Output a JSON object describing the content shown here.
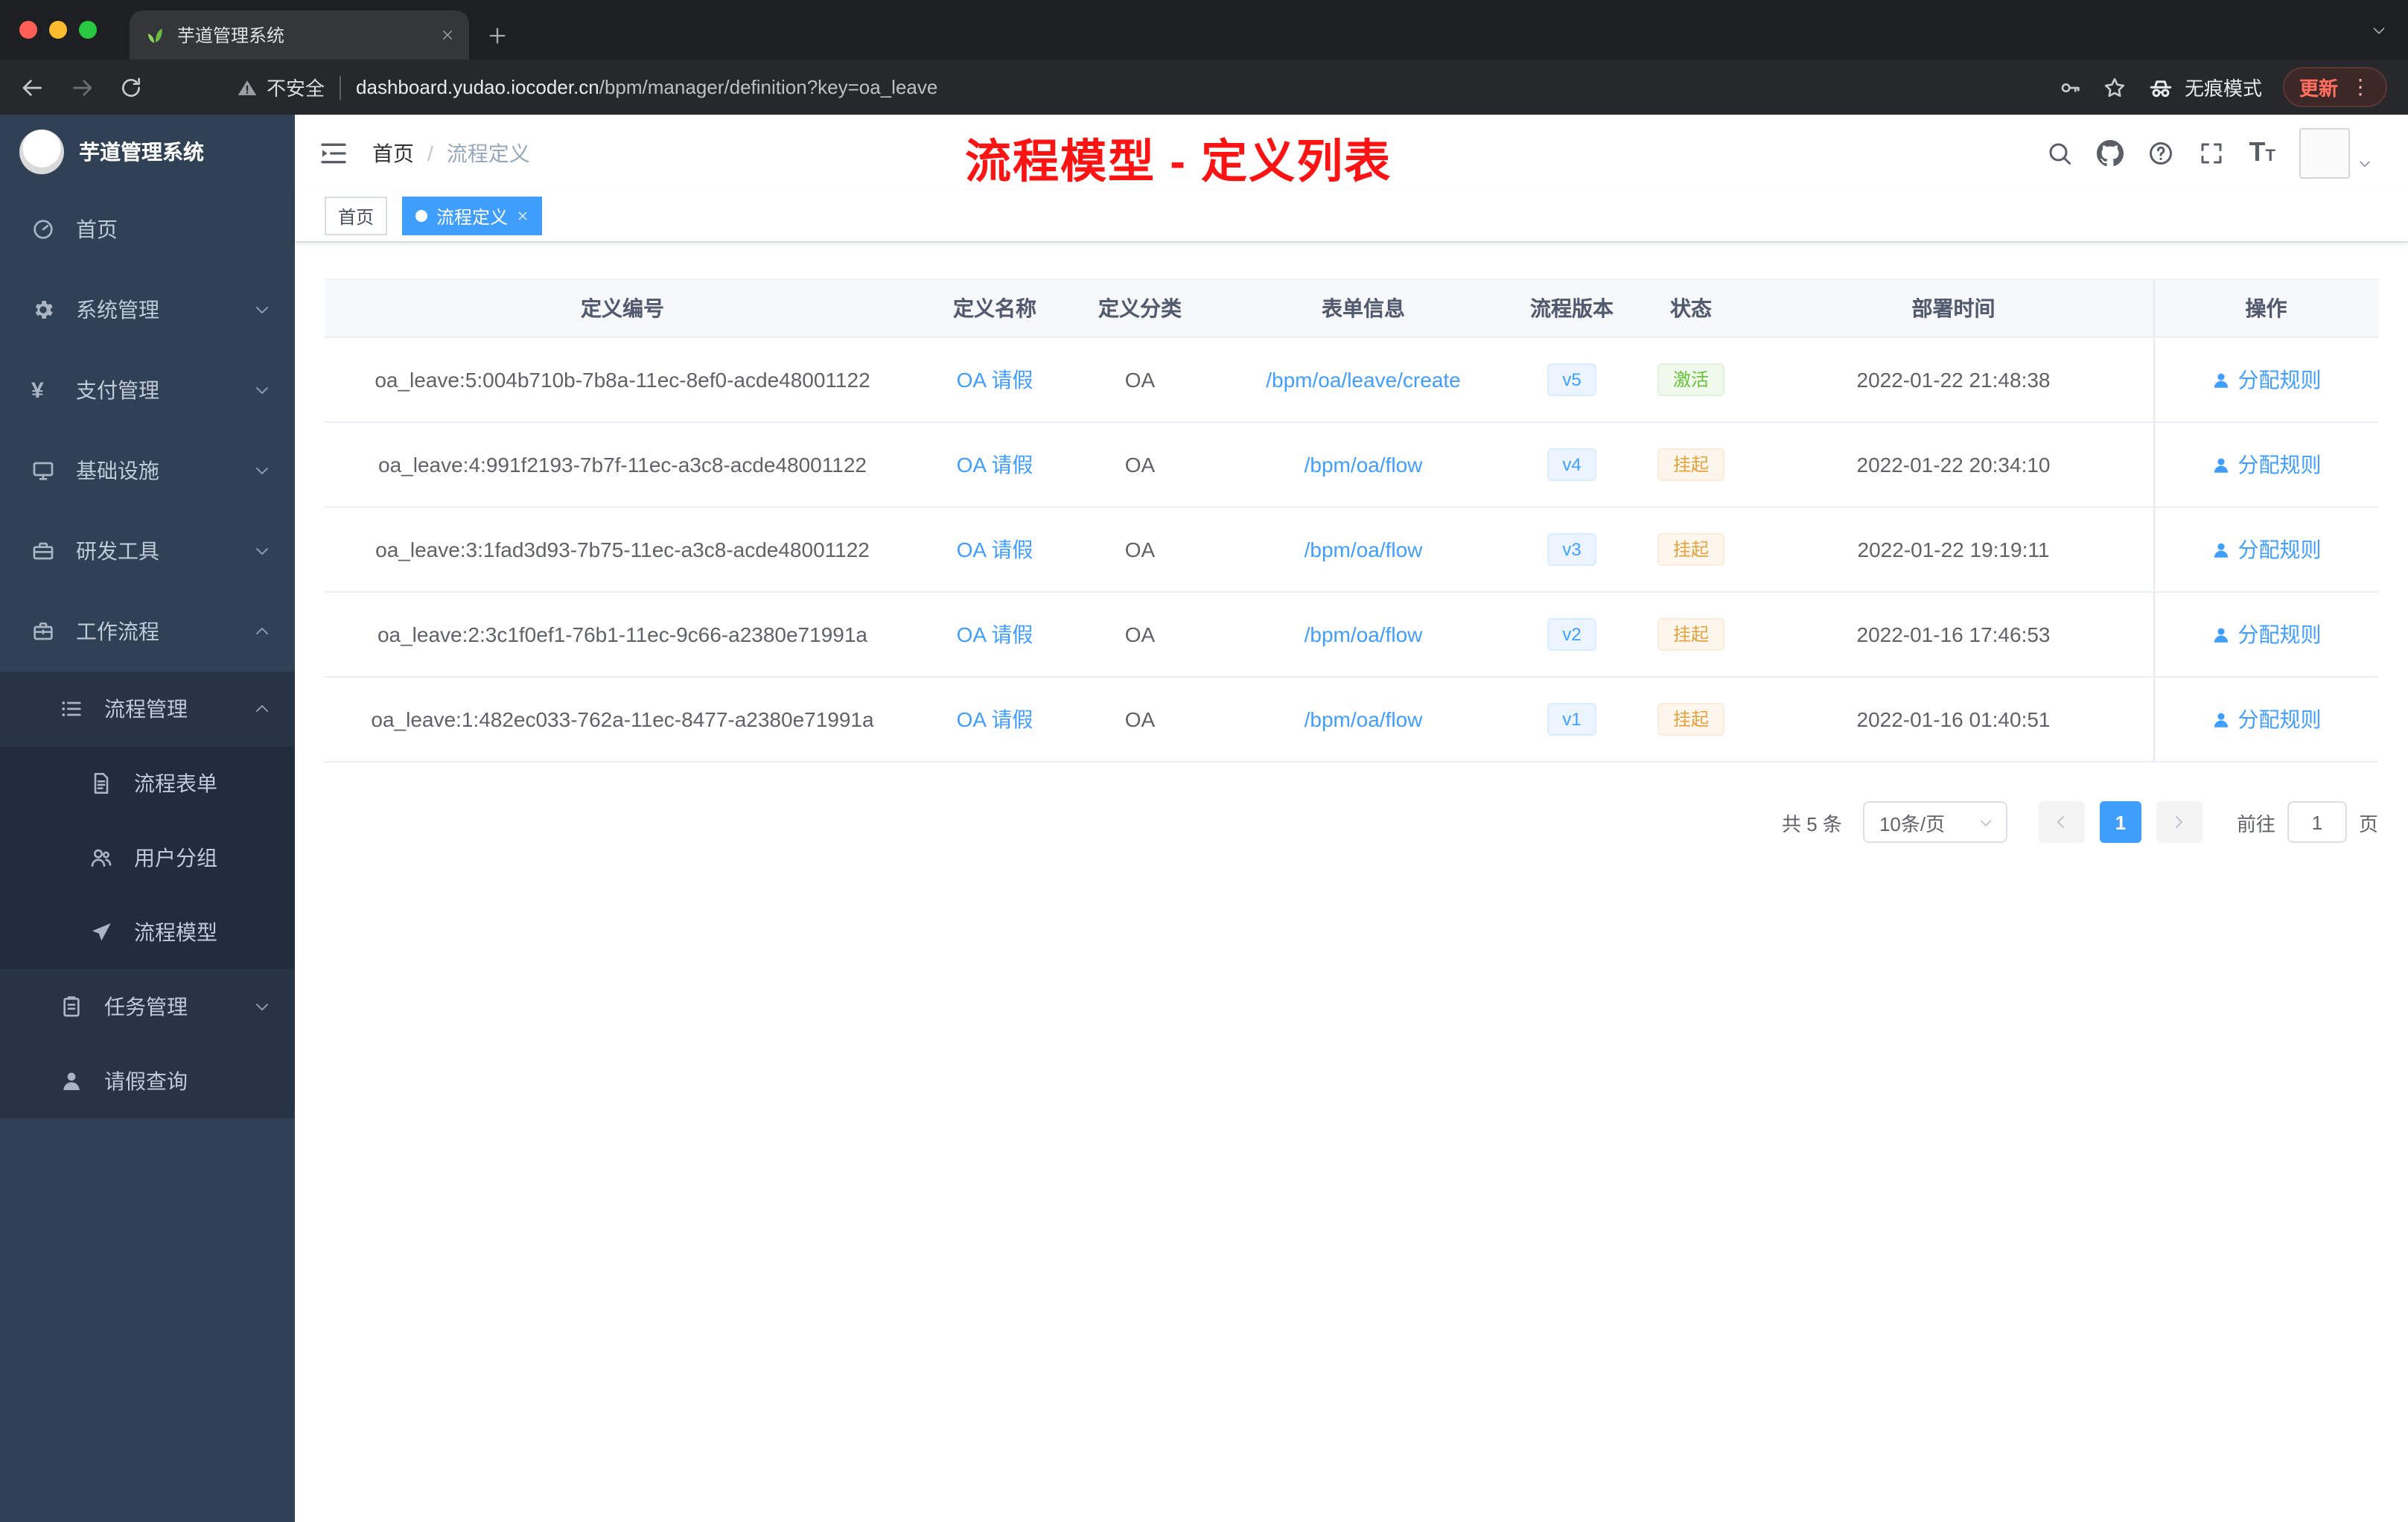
{
  "colors": {
    "accent": "#409eff",
    "annotation_red": "#fa1414",
    "success_text": "#67c23a",
    "success_bg": "#f0f9eb",
    "success_border": "#e1f3d8",
    "warning_text": "#e6a23c",
    "warning_bg": "#fdf6ec",
    "warning_border": "#faecd8",
    "version_bg": "#ecf5ff",
    "version_border": "#d9ecff",
    "sidebar_bg": "#304156",
    "sidebar_sub_bg": "#263445",
    "sidebar_sub2_bg": "#212d3d"
  },
  "browser": {
    "tab_title": "芋道管理系统",
    "security_label": "不安全",
    "url_domain": "dashboard.yudao.iocoder.cn",
    "url_path": "/bpm/manager/definition?key=oa_leave",
    "incognito_label": "无痕模式",
    "update_label": "更新"
  },
  "sidebar": {
    "logo_title": "芋道管理系统",
    "items": [
      {
        "label": "首页"
      },
      {
        "label": "系统管理"
      },
      {
        "label": "支付管理"
      },
      {
        "label": "基础设施"
      },
      {
        "label": "研发工具"
      },
      {
        "label": "工作流程"
      },
      {
        "label": "流程管理"
      },
      {
        "label": "流程表单"
      },
      {
        "label": "用户分组"
      },
      {
        "label": "流程模型"
      },
      {
        "label": "任务管理"
      },
      {
        "label": "请假查询"
      }
    ]
  },
  "navbar": {
    "breadcrumb_home": "首页",
    "breadcrumb_separator": "/",
    "breadcrumb_current": "流程定义",
    "annotation": "流程模型 - 定义列表"
  },
  "tags": {
    "home": "首页",
    "active": "流程定义"
  },
  "table": {
    "columns": [
      "定义编号",
      "定义名称",
      "定义分类",
      "表单信息",
      "流程版本",
      "状态",
      "部署时间",
      "操作"
    ],
    "rows": [
      {
        "id": "oa_leave:5:004b710b-7b8a-11ec-8ef0-acde48001122",
        "name": "OA 请假",
        "category": "OA",
        "form": "/bpm/oa/leave/create",
        "version": "v5",
        "status": "激活",
        "deploy_time": "2022-01-22 21:48:38",
        "action": "分配规则"
      },
      {
        "id": "oa_leave:4:991f2193-7b7f-11ec-a3c8-acde48001122",
        "name": "OA 请假",
        "category": "OA",
        "form": "/bpm/oa/flow",
        "version": "v4",
        "status": "挂起",
        "deploy_time": "2022-01-22 20:34:10",
        "action": "分配规则"
      },
      {
        "id": "oa_leave:3:1fad3d93-7b75-11ec-a3c8-acde48001122",
        "name": "OA 请假",
        "category": "OA",
        "form": "/bpm/oa/flow",
        "version": "v3",
        "status": "挂起",
        "deploy_time": "2022-01-22 19:19:11",
        "action": "分配规则"
      },
      {
        "id": "oa_leave:2:3c1f0ef1-76b1-11ec-9c66-a2380e71991a",
        "name": "OA 请假",
        "category": "OA",
        "form": "/bpm/oa/flow",
        "version": "v2",
        "status": "挂起",
        "deploy_time": "2022-01-16 17:46:53",
        "action": "分配规则"
      },
      {
        "id": "oa_leave:1:482ec033-762a-11ec-8477-a2380e71991a",
        "name": "OA 请假",
        "category": "OA",
        "form": "/bpm/oa/flow",
        "version": "v1",
        "status": "挂起",
        "deploy_time": "2022-01-16 01:40:51",
        "action": "分配规则"
      }
    ]
  },
  "pagination": {
    "total": "共 5 条",
    "page_size": "10条/页",
    "current_page": "1",
    "goto_label": "前往",
    "goto_value": "1",
    "page_unit": "页"
  }
}
